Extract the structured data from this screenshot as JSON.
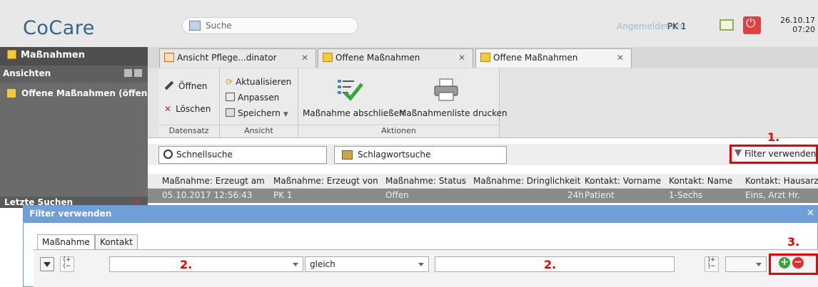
{
  "app": {
    "title": "CoCare"
  },
  "header": {
    "search_placeholder": "Suche",
    "login_label": "Angemeldet als:",
    "login_user": "PK 1",
    "date": "26.10.17",
    "time": "07:20"
  },
  "sidebar": {
    "title": "Maßnahmen",
    "views_title": "Ansichten",
    "view_item": "Offene Maßnahmen (öffen",
    "recent_title": "Letzte Suchen"
  },
  "tabs": [
    {
      "label": "Ansicht Pflege...dinator"
    },
    {
      "label": "Offene Maßnahmen"
    },
    {
      "label": "Offene Maßnahmen"
    }
  ],
  "ribbon": {
    "datensatz": {
      "open": "Öffnen",
      "delete": "Löschen",
      "label": "Datensatz"
    },
    "ansicht": {
      "refresh": "Aktualisieren",
      "adjust": "Anpassen",
      "save": "Speichern",
      "label": "Ansicht"
    },
    "aktionen": {
      "finish": "Maßnahme abschließen",
      "print": "Maßnahmenliste drucken",
      "label": "Aktionen"
    }
  },
  "toolbar": {
    "quick_search": "Schnellsuche",
    "keyword_search": "Schlagwortsuche",
    "filter_button": "Filter verwenden"
  },
  "annotations": {
    "step1": "1.",
    "step2": "2.",
    "step3": "3."
  },
  "table": {
    "columns": [
      "Maßnahme: Erzeugt am",
      "Maßnahme: Erzeugt von",
      "Maßnahme: Status",
      "Maßnahme: Dringlichkeit",
      "Kontakt: Vorname",
      "Kontakt: Name",
      "Kontakt: Hausarzt"
    ],
    "rows": [
      [
        "05.10.2017 12:56:43",
        "PK 1",
        "Offen",
        "24h",
        "Patient",
        "1-Sechs",
        "Eins, Arzt Hr."
      ]
    ]
  },
  "dialog": {
    "title": "Filter verwenden",
    "tabs": [
      "Maßnahme",
      "Kontakt"
    ],
    "operator": "gleich",
    "field1": "",
    "value": ""
  }
}
